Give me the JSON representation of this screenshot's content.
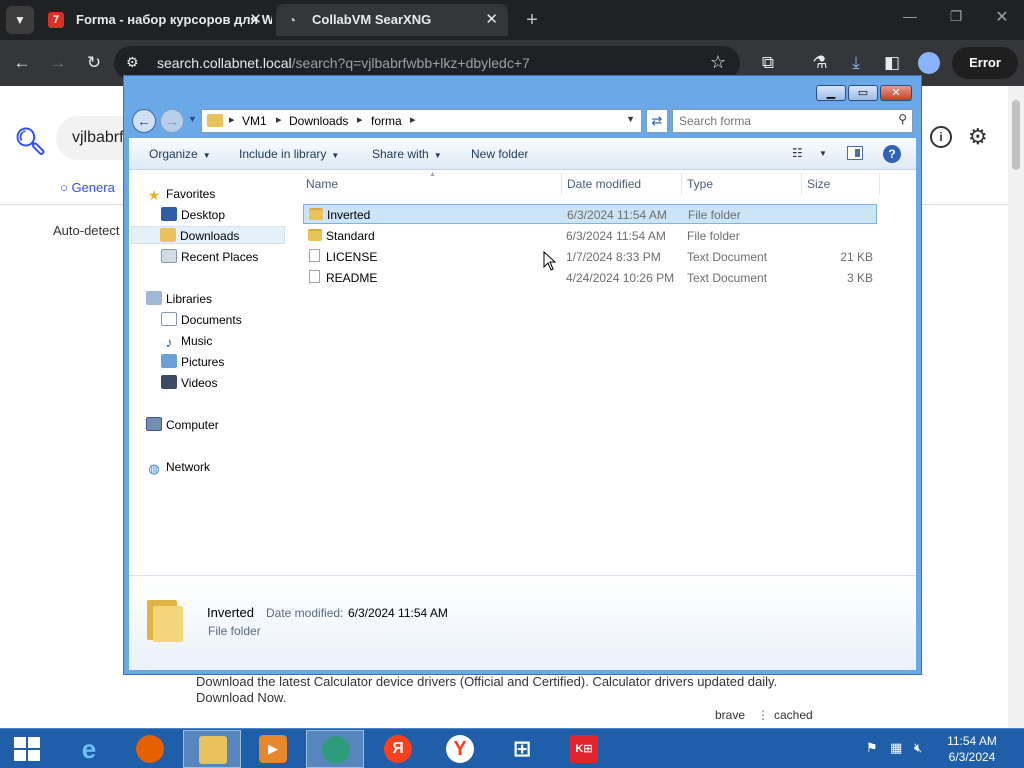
{
  "browser": {
    "tabs": [
      {
        "title": "Forma - набор курсоров для W",
        "favicon": "7"
      },
      {
        "title": "CollabVM SearXNG"
      }
    ],
    "url_host": "search.collabnet.local",
    "url_path": "/search?q=vjlbabrfwbb+lkz+dbyledc+7",
    "profile_status": "Error"
  },
  "webpage": {
    "search_value": "vjlbabrfwbb lkz dbyledc 7",
    "tab_general": "Genera",
    "autodetect": "Auto-detect",
    "result_snippet": "Download the latest Calculator device drivers (Official and Certified). Calculator drivers updated daily. Download Now.",
    "engine": "brave",
    "separator": "⋮",
    "cached": "cached"
  },
  "explorer": {
    "breadcrumb": [
      "VM1",
      "Downloads",
      "forma"
    ],
    "search_placeholder": "Search forma",
    "commands": {
      "organize": "Organize",
      "include_in_library": "Include in library",
      "share_with": "Share with",
      "new_folder": "New folder"
    },
    "nav": {
      "favorites": "Favorites",
      "desktop": "Desktop",
      "downloads": "Downloads",
      "recent_places": "Recent Places",
      "libraries": "Libraries",
      "documents": "Documents",
      "music": "Music",
      "pictures": "Pictures",
      "videos": "Videos",
      "computer": "Computer",
      "network": "Network"
    },
    "columns": {
      "name": "Name",
      "date": "Date modified",
      "type": "Type",
      "size": "Size"
    },
    "files": [
      {
        "name": "Inverted",
        "date": "6/3/2024 11:54 AM",
        "type": "File folder",
        "size": ""
      },
      {
        "name": "Standard",
        "date": "6/3/2024 11:54 AM",
        "type": "File folder",
        "size": ""
      },
      {
        "name": "LICENSE",
        "date": "1/7/2024 8:33 PM",
        "type": "Text Document",
        "size": "21 KB"
      },
      {
        "name": "README",
        "date": "4/24/2024 10:26 PM",
        "type": "Text Document",
        "size": "3 KB"
      }
    ],
    "details": {
      "name": "Inverted",
      "date_label": "Date modified:",
      "date_value": "6/3/2024 11:54 AM",
      "type": "File folder"
    }
  },
  "taskbar": {
    "apps": [
      "ie-icon",
      "firefox-icon",
      "explorer-icon",
      "media-player-icon",
      "collabvm-icon",
      "yandex-icon",
      "yandex-browser-icon",
      "windows-tile-icon",
      "kl-icon"
    ],
    "yandex_letter": "Я",
    "kl_label": "K⊞",
    "time": "11:54 AM",
    "date": "6/3/2024"
  }
}
